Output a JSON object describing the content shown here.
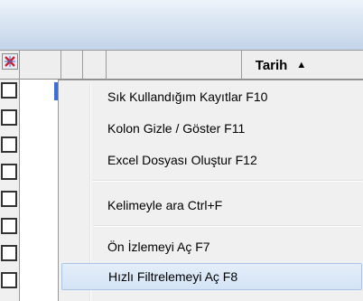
{
  "grid": {
    "header": {
      "clear_filter_icon": "clear-filter-icon",
      "column_title": "Tarih",
      "sort_glyph": "▲",
      "sort_direction": "ascending"
    },
    "row_checkboxes": 8
  },
  "context_menu": {
    "items": [
      {
        "label": "Sık Kullandığım Kayıtlar  F10"
      },
      {
        "label": "Kolon Gizle / Göster  F11"
      },
      {
        "label": "Excel Dosyası Oluştur F12"
      },
      {
        "label": "Kelimeyle ara  Ctrl+F"
      },
      {
        "label": "Ön İzlemeyi Aç F7"
      },
      {
        "label": "Hızlı Filtrelemeyi Aç F8"
      }
    ],
    "highlighted_index": 5
  },
  "colors": {
    "title_bar": "#cfdded",
    "menu_bg": "#f0f0f0",
    "highlight": "#d4e4f6",
    "clear_filter_red": "#d0202a"
  }
}
